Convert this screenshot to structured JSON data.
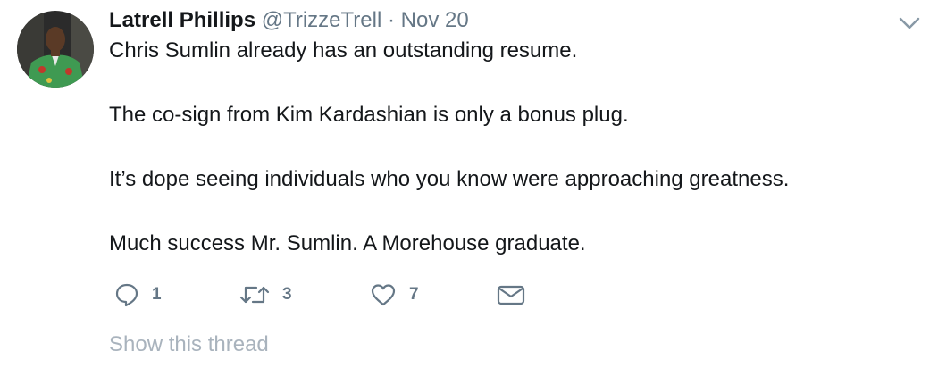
{
  "author": {
    "name": "Latrell Phillips",
    "handle": "@TrizzeTrell",
    "separator": "·",
    "date": "Nov 20"
  },
  "tweet": {
    "paragraphs": [
      "Chris Sumlin already has an outstanding resume.",
      "The co-sign from Kim Kardashian is only a bonus plug.",
      "It’s dope seeing individuals who you know were approaching greatness.",
      "Much success Mr. Sumlin. A Morehouse graduate."
    ]
  },
  "actions": {
    "reply": {
      "icon": "reply-icon",
      "count": "1"
    },
    "retweet": {
      "icon": "retweet-icon",
      "count": "3"
    },
    "like": {
      "icon": "heart-icon",
      "count": "7"
    },
    "dm": {
      "icon": "envelope-icon"
    }
  },
  "show_thread": "Show this thread",
  "colors": {
    "text": "#14171a",
    "secondary": "#657786",
    "link_muted": "#a9b3bd"
  }
}
